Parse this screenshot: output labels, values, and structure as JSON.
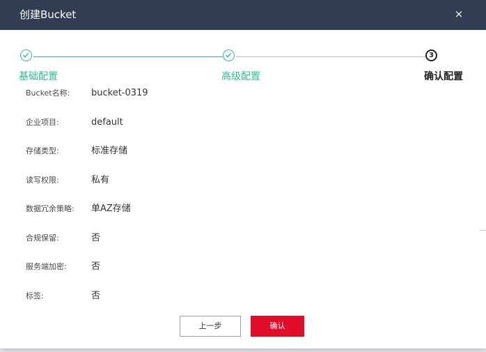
{
  "dialog": {
    "title": "创建Bucket",
    "close_glyph": "×"
  },
  "steps": [
    {
      "label": "基础配置",
      "status": "done",
      "icon": "check-icon"
    },
    {
      "label": "高级配置",
      "status": "done",
      "icon": "check-icon"
    },
    {
      "label": "确认配置",
      "status": "active",
      "number": "3"
    }
  ],
  "fields": [
    {
      "label": "Bucket名称:",
      "value": "bucket-0319"
    },
    {
      "label": "企业项目:",
      "value": "default"
    },
    {
      "label": "存储类型:",
      "value": "标准存储"
    },
    {
      "label": "读写权限:",
      "value": "私有"
    },
    {
      "label": "数据冗余策略:",
      "value": "单AZ存储"
    },
    {
      "label": "合规保留:",
      "value": "否"
    },
    {
      "label": "服务端加密:",
      "value": "否"
    },
    {
      "label": "标签:",
      "value": "否"
    }
  ],
  "buttons": {
    "prev_label": "上一步",
    "confirm_label": "确认"
  },
  "colors": {
    "header_bg": "#323c52",
    "step_done": "#2dc08a",
    "step_todo": "#b9bcc3",
    "primary": "#e10e2b"
  }
}
